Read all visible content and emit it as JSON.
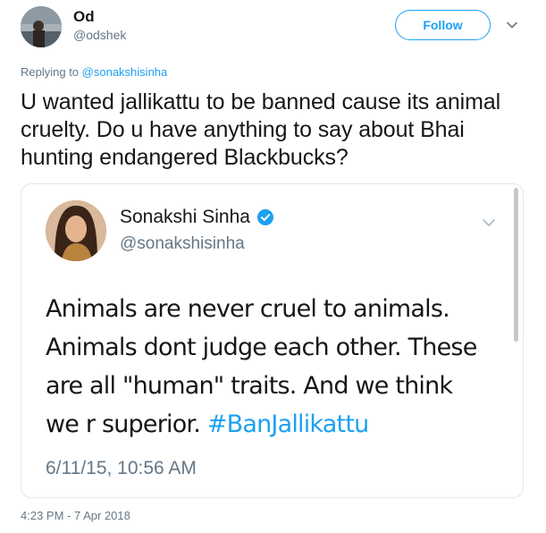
{
  "author": {
    "display_name": "Od",
    "handle": "@odshek"
  },
  "follow_label": "Follow",
  "reply": {
    "prefix": "Replying to",
    "target": "@sonakshisinha"
  },
  "tweet_text": "U wanted jallikattu to be banned cause its animal cruelty. Do u have anything to say about Bhai hunting endangered Blackbucks?",
  "embedded": {
    "display_name": "Sonakshi Sinha",
    "handle": "@sonakshisinha",
    "text": "Animals are never cruel to animals. Animals dont judge each other. These are all \"human\" traits. And we think we r superior.",
    "hashtag": "#BanJallikattu",
    "time": "6/11/15, 10:56 AM"
  },
  "timestamp": "4:23 PM - 7 Apr 2018",
  "colors": {
    "accent": "#1da1f2",
    "secondary_text": "#657786",
    "border": "#e1e8ed"
  },
  "icons": [
    "caret-down-icon",
    "verified-badge-icon"
  ]
}
